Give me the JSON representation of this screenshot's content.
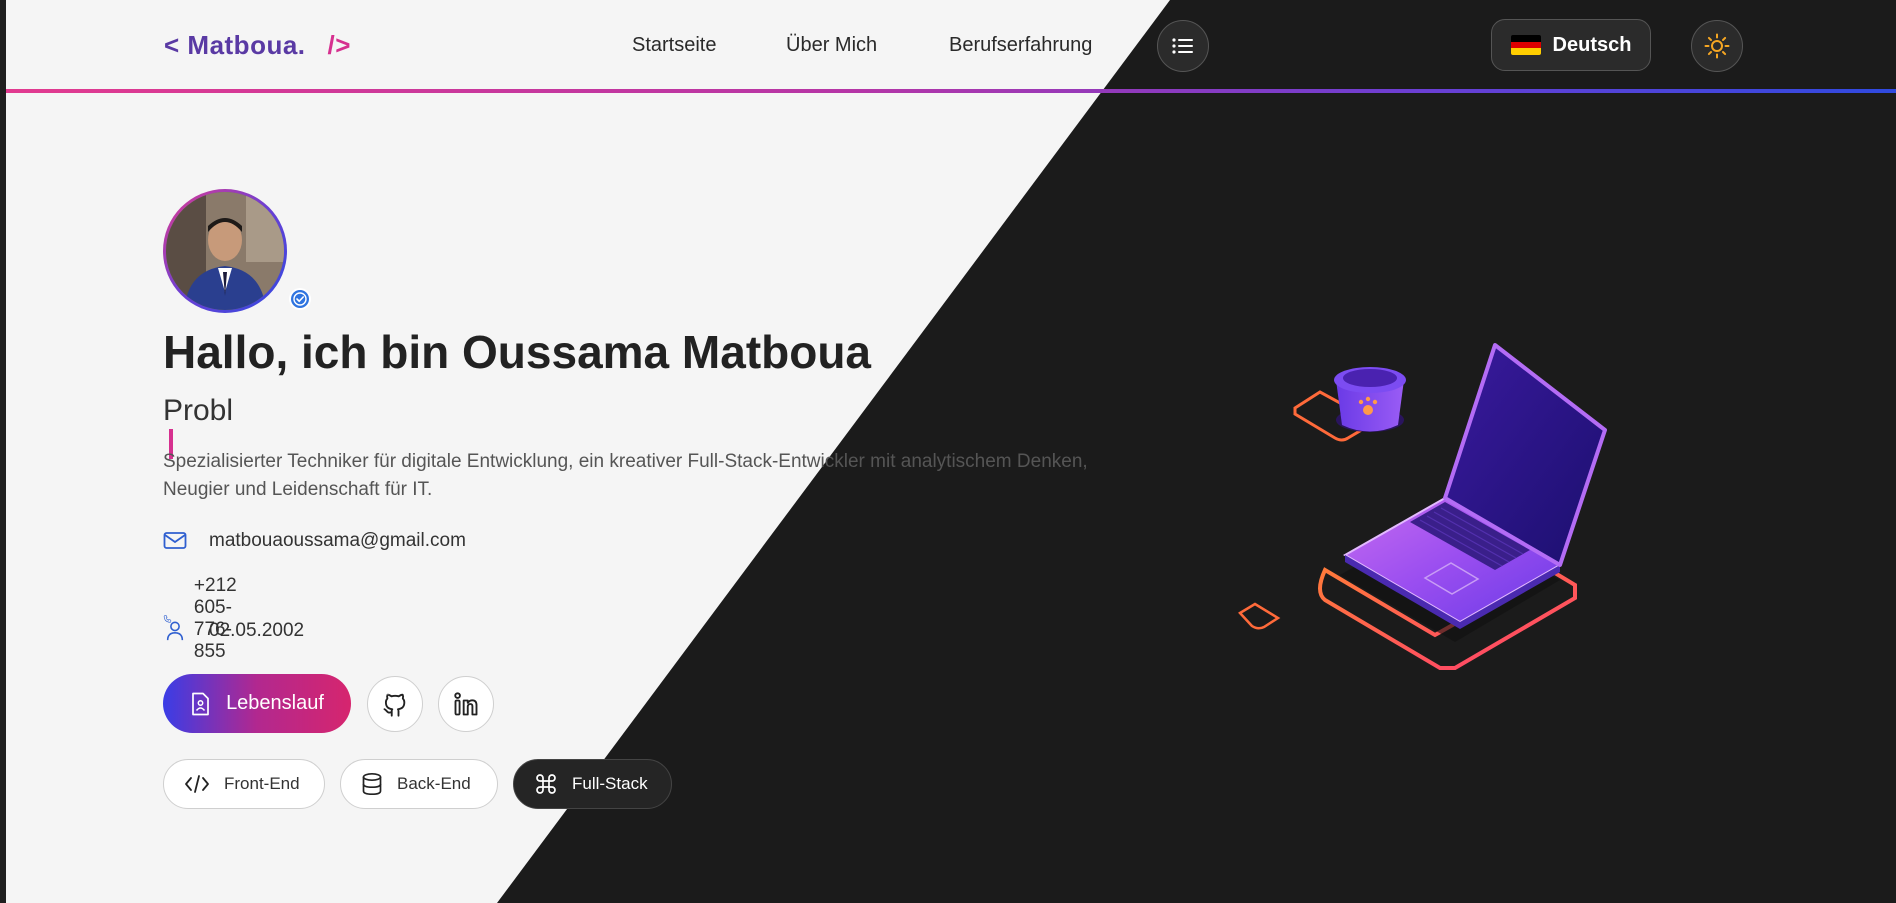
{
  "header": {
    "logo": {
      "open": "< Matboua.",
      "close": "/>"
    },
    "nav": [
      "Startseite",
      "Über Mich",
      "Berufserfahrung"
    ],
    "menu_icon": "list-icon",
    "language": {
      "label": "Deutsch",
      "flag": "germany-flag-icon"
    },
    "theme_icon": "sun-icon"
  },
  "hero": {
    "avatar": "profile-photo",
    "verified_icon": "verified-badge-icon",
    "title": "Hallo, ich bin Oussama Matboua",
    "typed_subtitle": "Probl",
    "description": "Spezialisierter Techniker für digitale Entwicklung, ein kreativer Full-Stack-Entwickler mit analytischem Denken, Neugier und Leidenschaft für IT.",
    "contact": [
      {
        "icon": "mail-icon",
        "value": "matbouaoussama@gmail.com"
      },
      {
        "icon": "phone-icon",
        "value": "+212 605-776-855"
      },
      {
        "icon": "user-icon",
        "value": "02.05.2002"
      }
    ],
    "cta": {
      "label": "Lebenslauf",
      "icon": "document-icon"
    },
    "social": [
      {
        "name": "github-icon"
      },
      {
        "name": "linkedin-icon"
      }
    ],
    "skills": [
      {
        "label": "Front-End",
        "icon": "code-icon"
      },
      {
        "label": "Back-End",
        "icon": "database-icon"
      },
      {
        "label": "Full-Stack",
        "icon": "command-icon"
      }
    ]
  },
  "colors": {
    "light_bg": "#f5f5f5",
    "dark_bg": "#1b1b1b",
    "accent_pink": "#d6308f",
    "accent_blue": "#3a3de6",
    "accent_purple": "#6b3fd4"
  }
}
